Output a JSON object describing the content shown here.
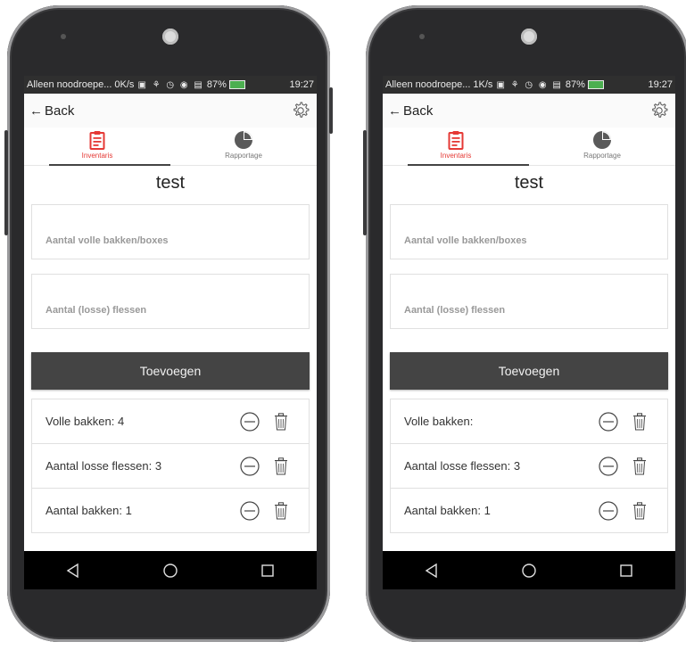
{
  "phones": [
    {
      "statusbar": {
        "carrier": "Alleen noodroepe...",
        "speed": "0K/s",
        "battery": "87%",
        "time": "19:27"
      },
      "topbar": {
        "back_label": "Back"
      },
      "tabs": [
        {
          "label": "Inventaris"
        },
        {
          "label": "Rapportage"
        }
      ],
      "form": {
        "title": "test",
        "field1_placeholder": "Aantal volle bakken/boxes",
        "field2_placeholder": "Aantal (losse) flessen",
        "add_button": "Toevoegen"
      },
      "list": [
        {
          "label": "Volle bakken: 4"
        },
        {
          "label": "Aantal losse flessen: 3"
        },
        {
          "label": "Aantal bakken: 1"
        }
      ]
    },
    {
      "statusbar": {
        "carrier": "Alleen noodroepe...",
        "speed": "1K/s",
        "battery": "87%",
        "time": "19:27"
      },
      "topbar": {
        "back_label": "Back"
      },
      "tabs": [
        {
          "label": "Inventaris"
        },
        {
          "label": "Rapportage"
        }
      ],
      "form": {
        "title": "test",
        "field1_placeholder": "Aantal volle bakken/boxes",
        "field2_placeholder": "Aantal (losse) flessen",
        "add_button": "Toevoegen"
      },
      "list": [
        {
          "label": "Volle bakken:"
        },
        {
          "label": "Aantal losse flessen: 3"
        },
        {
          "label": "Aantal bakken: 1"
        }
      ]
    }
  ],
  "colors": {
    "accent": "#e53935",
    "button_bg": "#444444",
    "statusbar_bg": "#2f2f2f",
    "navbar_bg": "#000000"
  },
  "icons": [
    "back-arrow-icon",
    "gear-icon",
    "clipboard-icon",
    "pie-chart-icon",
    "minus-circle-icon",
    "trash-icon",
    "nav-back-icon",
    "nav-home-icon",
    "nav-recents-icon"
  ]
}
